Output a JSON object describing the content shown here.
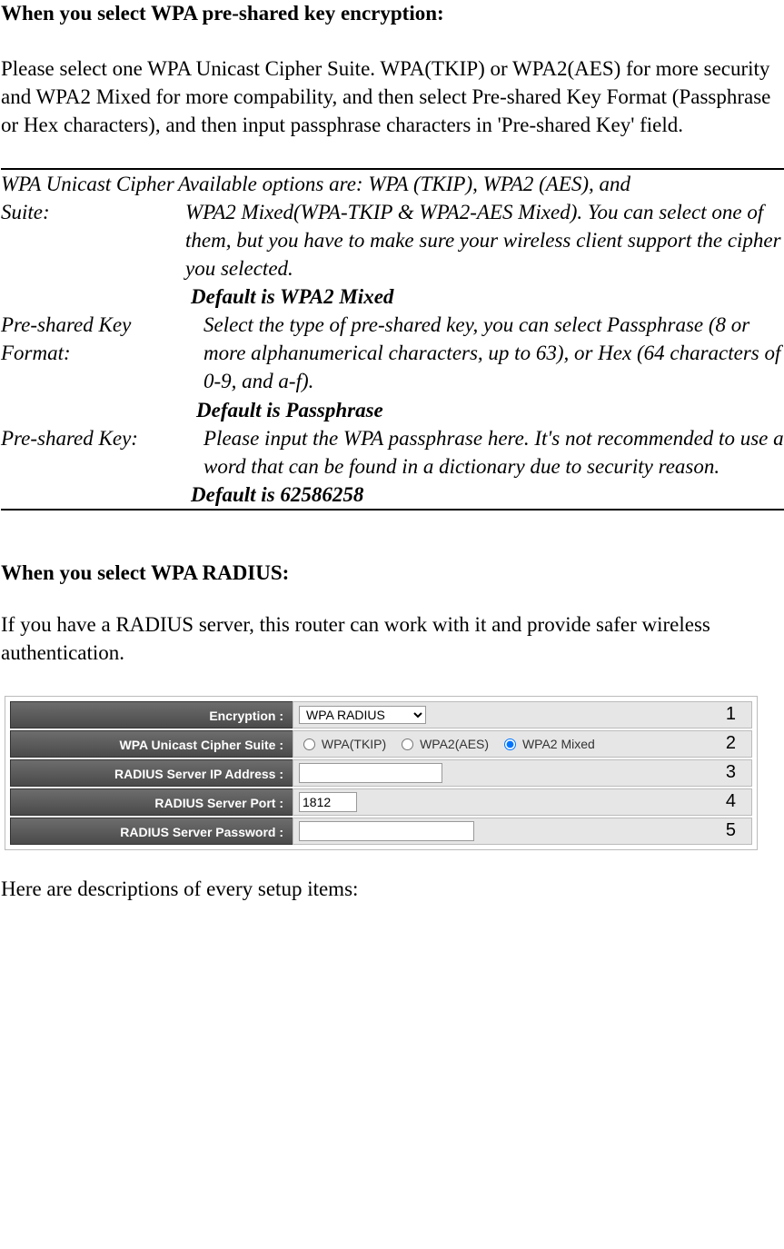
{
  "section1": {
    "title": "When you select WPA pre-shared key encryption:",
    "intro": "Please select one WPA Unicast Cipher Suite.\nWPA(TKIP) or WPA2(AES) for more security and WPA2 Mixed for more compability, and then select Pre-shared Key Format (Passphrase or Hex characters), and then input passphrase characters in 'Pre-shared Key' field."
  },
  "params": {
    "row1": {
      "label": "WPA Unicast Cipher Suite:",
      "desc_line1": "Available options are: WPA (TKIP), WPA2 (AES), and",
      "desc_rest": "WPA2 Mixed(WPA-TKIP & WPA2-AES Mixed). You can select one of them, but you have to make sure your wireless client support the cipher you selected.",
      "default": "Default is WPA2 Mixed"
    },
    "row2": {
      "label": "Pre-shared Key Format:",
      "desc": "Select the type of pre-shared key, you can select Passphrase (8 or more alphanumerical characters, up to 63), or Hex (64 characters of 0-9, and a-f).",
      "default": "Default is Passphrase"
    },
    "row3": {
      "label": "Pre-shared Key:",
      "desc": "Please input the WPA passphrase here. It's not recommended to use a word that can be found in a dictionary due to security reason.",
      "default": "Default is 62586258"
    }
  },
  "section2": {
    "title": "When you select WPA RADIUS:",
    "intro": "If you have a RADIUS server, this router can work with it and provide safer wireless authentication.",
    "closing": "Here are descriptions of every setup items:"
  },
  "panel": {
    "rows": {
      "r1": {
        "num": "1",
        "label": "Encryption :",
        "select_value": "WPA RADIUS"
      },
      "r2": {
        "num": "2",
        "label": "WPA Unicast Cipher Suite :",
        "opt1": "WPA(TKIP)",
        "opt2": "WPA2(AES)",
        "opt3": "WPA2 Mixed"
      },
      "r3": {
        "num": "3",
        "label": "RADIUS Server IP Address :",
        "value": ""
      },
      "r4": {
        "num": "4",
        "label": "RADIUS Server Port :",
        "value": "1812"
      },
      "r5": {
        "num": "5",
        "label": "RADIUS Server Password :",
        "value": ""
      }
    }
  }
}
